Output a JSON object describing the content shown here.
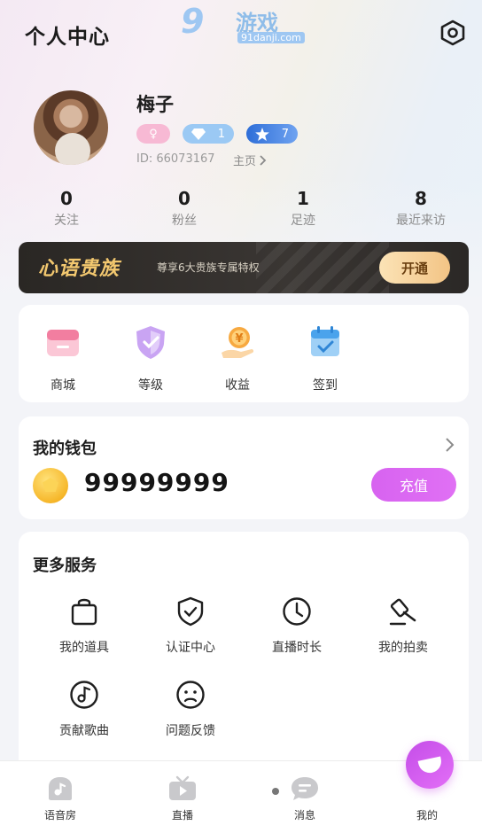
{
  "header": {
    "title": "个人中心",
    "watermark": {
      "logo_number": "9",
      "logo_text": "游戏",
      "url": "91danji.com"
    }
  },
  "profile": {
    "name": "梅子",
    "gender_symbol": "♀",
    "diamond_level": "1",
    "star_level": "7",
    "id_text": "ID: 66073167",
    "home_link": "主页"
  },
  "stats": [
    {
      "value": "0",
      "label": "关注"
    },
    {
      "value": "0",
      "label": "粉丝"
    },
    {
      "value": "1",
      "label": "足迹"
    },
    {
      "value": "8",
      "label": "最近来访"
    }
  ],
  "vip": {
    "title": "心语贵族",
    "description": "尊享6大贵族专属特权",
    "button": "开通"
  },
  "quick_actions": [
    {
      "label": "商城",
      "icon": "shop-icon"
    },
    {
      "label": "等级",
      "icon": "level-shield-icon"
    },
    {
      "label": "收益",
      "icon": "earnings-coin-icon"
    },
    {
      "label": "签到",
      "icon": "calendar-checkin-icon"
    }
  ],
  "wallet": {
    "title": "我的钱包",
    "balance": "99999999",
    "recharge_button": "充值"
  },
  "services": {
    "title": "更多服务",
    "items": [
      {
        "label": "我的道具",
        "icon": "bag-icon"
      },
      {
        "label": "认证中心",
        "icon": "shield-check-icon"
      },
      {
        "label": "直播时长",
        "icon": "clock-icon"
      },
      {
        "label": "我的拍卖",
        "icon": "gavel-icon"
      },
      {
        "label": "贡献歌曲",
        "icon": "music-disc-icon"
      },
      {
        "label": "问题反馈",
        "icon": "frown-face-icon"
      }
    ]
  },
  "bottom_nav": [
    {
      "label": "语音房",
      "icon": "voice-room-icon"
    },
    {
      "label": "直播",
      "icon": "tv-live-icon"
    },
    {
      "label": "消息",
      "icon": "chat-bubble-icon"
    },
    {
      "label": "我的",
      "icon": "profile-icon"
    }
  ],
  "colors": {
    "accent_purple": "#d763f0",
    "vip_gold": "#f3c86f",
    "vip_dark": "#2a2724",
    "background": "#f3f4f8"
  }
}
